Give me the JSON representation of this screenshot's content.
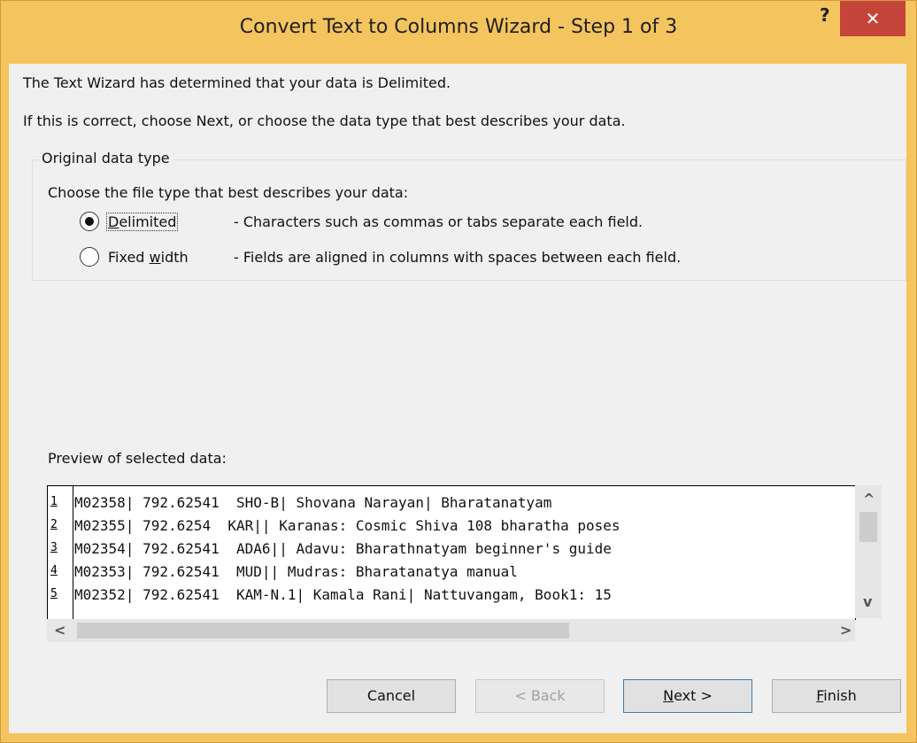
{
  "window": {
    "title": "Convert Text to Columns Wizard - Step 1 of 3",
    "help_label": "?",
    "close_label": "✕"
  },
  "intro": {
    "line1": "The Text Wizard has determined that your data is Delimited.",
    "line2": "If this is correct, choose Next, or choose the data type that best describes your data."
  },
  "group": {
    "label": "Original data type",
    "prompt": "Choose the file type that best describes your data:",
    "options": [
      {
        "label_pre": "",
        "label_u": "D",
        "label_post": "elimited",
        "description": "- Characters such as commas or tabs separate each field.",
        "selected": true
      },
      {
        "label_pre": "Fixed ",
        "label_u": "w",
        "label_post": "idth",
        "description": "- Fields are aligned in columns with spaces between each field.",
        "selected": false
      }
    ]
  },
  "preview": {
    "label": "Preview of selected data:",
    "line_numbers": [
      "1",
      "2",
      "3",
      "4",
      "5"
    ],
    "rows": [
      "M02358| 792.62541  SHO-B| Shovana Narayan| Bharatanatyam",
      "M02355| 792.6254  KAR|| Karanas: Cosmic Shiva 108 bharatha poses",
      "M02354| 792.62541  ADA6|| Adavu: Bharathnatyam beginner's guide",
      "M02353| 792.62541  MUD|| Mudras: Bharatanatya manual",
      "M02352| 792.62541  KAM-N.1| Kamala Rani| Nattuvangam, Book1: 15"
    ],
    "scroll_up_icon": "^",
    "scroll_down_icon": "v",
    "scroll_left_icon": "<",
    "scroll_right_icon": ">"
  },
  "buttons": {
    "cancel": "Cancel",
    "back": "< Back",
    "next_u": "N",
    "next_rest": "ext >",
    "finish_u": "F",
    "finish_rest": "inish"
  }
}
